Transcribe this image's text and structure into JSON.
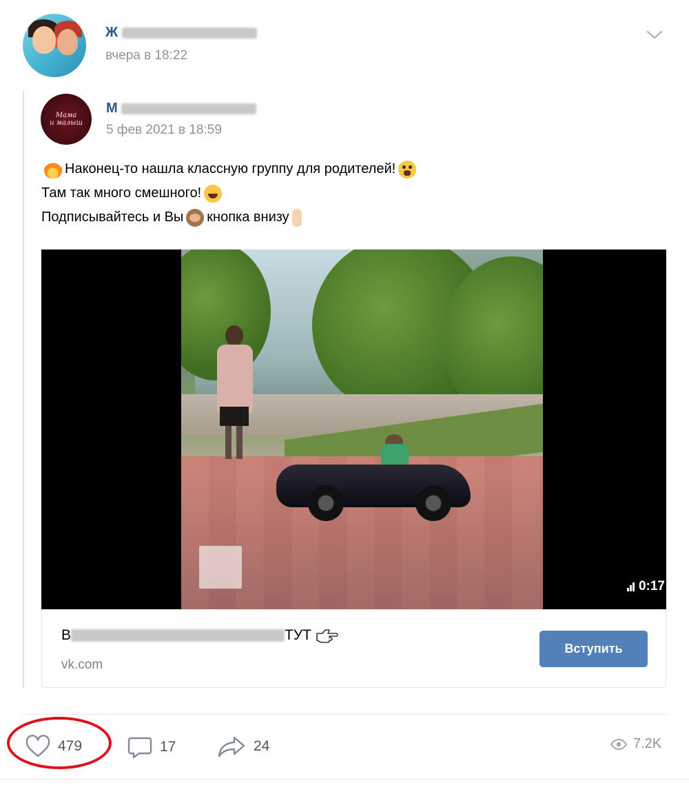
{
  "outer_post": {
    "author_name": "Ж",
    "time": "вчера в 18:22"
  },
  "repost": {
    "author_name": "М",
    "time": "5 фев 2021 в 18:59",
    "avatar_text": [
      "Мама",
      "и малыш"
    ],
    "text_lines": [
      "Наконец-то нашла классную группу для родителей!",
      "Там так много смешного!",
      "Подписывайтесь и Вы",
      "кнопка внизу"
    ]
  },
  "video": {
    "duration": "0:17"
  },
  "link_card": {
    "title_start": "В",
    "title_end": "ТУТ",
    "domain": "vk.com",
    "button_label": "Вступить"
  },
  "actions": {
    "likes": "479",
    "comments": "17",
    "shares": "24",
    "views": "7.2K"
  },
  "colors": {
    "link_blue": "#2a5885",
    "button_blue": "#5181b8",
    "highlight_red": "#e0101a",
    "meta_gray": "#939393"
  },
  "icons": [
    "chevron-down-icon",
    "fire-icon",
    "scream-icon",
    "laugh-icon",
    "see-no-evil-monkey-icon",
    "pointing-down-icon",
    "pointing-right-icon",
    "heart-icon",
    "comment-icon",
    "share-icon",
    "eye-icon",
    "signal-bars-icon"
  ]
}
